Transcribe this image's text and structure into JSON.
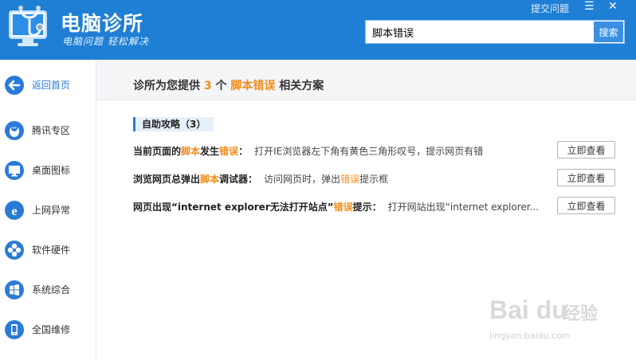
{
  "app": {
    "title": "电脑诊所",
    "slogan": "电脑问题 轻松解决",
    "report_link": "提交问题",
    "window_controls": {
      "menu_icon": "menu-icon",
      "close_icon": "close-icon"
    }
  },
  "search": {
    "value": "脚本错误",
    "button_label": "搜索"
  },
  "sidebar": {
    "items": [
      {
        "label": "返回首页",
        "icon": "back-arrow-icon"
      },
      {
        "label": "腾讯专区",
        "icon": "qq-penguin-icon"
      },
      {
        "label": "桌面图标",
        "icon": "monitor-icon"
      },
      {
        "label": "上网异常",
        "icon": "ie-browser-icon"
      },
      {
        "label": "软件硬件",
        "icon": "puzzle-icon"
      },
      {
        "label": "系统综合",
        "icon": "windows-icon"
      },
      {
        "label": "全国维修",
        "icon": "phone-icon"
      }
    ]
  },
  "main": {
    "heading": {
      "prefix": "诊所为您提供",
      "count": "3",
      "unit": "个",
      "keyword": "脚本错误",
      "suffix": "相关方案"
    },
    "section_label": "自助攻略（3）",
    "results": [
      {
        "title_parts": [
          "当前页面的",
          "脚本",
          "发生",
          "错误",
          "："
        ],
        "desc": "打开IE浏览器左下角有黄色三角形叹号，提示网页有错",
        "button": "立即查看"
      },
      {
        "title_parts": [
          "浏览网页总弹出",
          "脚本",
          "调试器："
        ],
        "desc_parts": [
          "访问网页时，弹出",
          "错误",
          "提示框"
        ],
        "button": "立即查看"
      },
      {
        "title_parts": [
          "网页出现“internet explorer无法打开站点”",
          "错误",
          "提示："
        ],
        "desc": "打开网站出现“internet explorer...",
        "button": "立即查看"
      }
    ]
  },
  "watermark": {
    "logo": "Bai du",
    "cn": "经验",
    "url": "jingyan.baidu.com"
  },
  "colors": {
    "header": "#1f7fd4",
    "accent": "#2b7bd6",
    "highlight": "#f08c1a"
  }
}
